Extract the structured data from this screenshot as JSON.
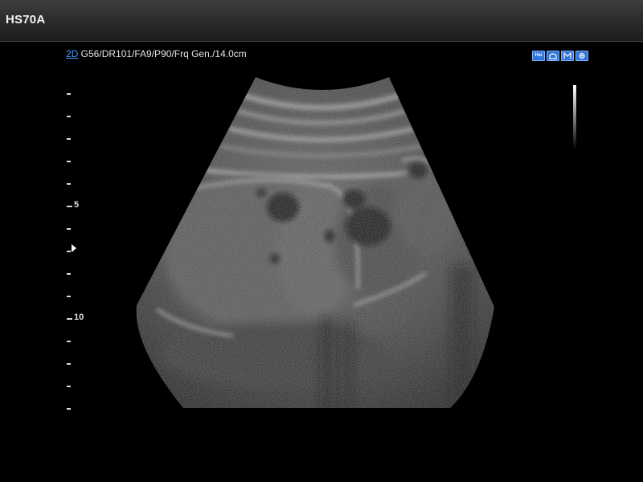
{
  "app": {
    "title": "HS70A"
  },
  "scan_params": {
    "mode": "2D",
    "text": " G56/DR101/FA9/P90/Frq Gen./14.0cm"
  },
  "toolbar_icons": [
    {
      "name": "hsi-icon",
      "label": "Hsi"
    },
    {
      "name": "probe-icon",
      "label": ""
    },
    {
      "name": "measure-icon",
      "label": ""
    },
    {
      "name": "zoom-icon",
      "label": ""
    }
  ],
  "depth_scale": {
    "labels": [
      "5",
      "10"
    ],
    "unit": "cm"
  }
}
